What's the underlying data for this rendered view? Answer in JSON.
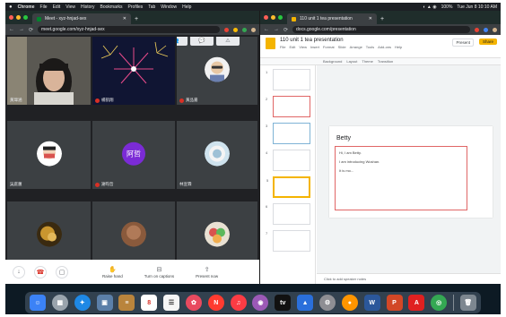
{
  "menubar": {
    "app": "Chrome",
    "items": [
      "File",
      "Edit",
      "View",
      "History",
      "Bookmarks",
      "Profiles",
      "Tab",
      "Window",
      "Help"
    ],
    "battery": "100%",
    "clock": "Tue Jun 8 10:10 AM"
  },
  "meet_window": {
    "tab_title": "Meet - xyz-hnjad-sex",
    "url": "meet.google.com/xyz-hnjad-sex",
    "tiles": [
      {
        "name": "黃瑋涵",
        "kind": "camera-girl"
      },
      {
        "name": "楊凱翔",
        "kind": "fireworks"
      },
      {
        "name": "黃品嘉",
        "kind": "avatar-glasses"
      },
      {
        "name": "吳庭蕙",
        "kind": "avatar-mask"
      },
      {
        "name": "謝昀哲",
        "kind": "circle",
        "initials": "阿哲"
      },
      {
        "name": "林宣霖",
        "kind": "avatar-blue"
      },
      {
        "name": "許庭恩",
        "kind": "avatar-dog"
      },
      {
        "name": "謝昀真",
        "kind": "avatar-brown"
      },
      {
        "name": "林芝寧",
        "kind": "avatar-food"
      }
    ],
    "controls": {
      "mic_icon": "↓",
      "hangup_icon": "☎",
      "camera_icon": "▢",
      "raise_hand_icon": "✋",
      "raise_hand": "Raise hand",
      "captions_icon": "⊟",
      "captions": "Turn on captions",
      "present_icon": "⇪",
      "present": "Present now"
    },
    "top_icons": [
      "👥",
      "💬",
      "⚠"
    ]
  },
  "slides_window": {
    "tab_title": "110 unit 1 tea presentation",
    "url": "docs.google.com/presentation",
    "doc_title": "110 unit 1 tea presentation",
    "menu": [
      "File",
      "Edit",
      "View",
      "Insert",
      "Format",
      "Slide",
      "Arrange",
      "Tools",
      "Add-ons",
      "Help"
    ],
    "toolbar": [
      "Background",
      "Layout",
      "Theme",
      "Transition"
    ],
    "present_label": "Present",
    "share_label": "Share",
    "slide": {
      "heading": "Betty",
      "lines": [
        "Hi, I am Betty.",
        "I am introducing Wushan.",
        "It is mo..."
      ]
    },
    "thumb_numbers": [
      "1",
      "2",
      "3",
      "4",
      "5",
      "6",
      "7"
    ],
    "notes_placeholder": "Click to add speaker notes"
  },
  "dock": {
    "apps": [
      "Finder",
      "Launchpad",
      "Safari",
      "Preview",
      "Notes",
      "Calendar",
      "Photos",
      "Chrome",
      "News",
      "Music",
      "Podcasts",
      "TV",
      "Keynote",
      "System Preferences",
      "Zoom",
      "Word",
      "PowerPoint",
      "Acrobat",
      "Chrome",
      "Trash"
    ]
  },
  "colors": {
    "meet_bg": "#202124",
    "tile_bg": "#3c4043",
    "slides_accent": "#f4b400",
    "hangup_red": "#d93025"
  }
}
